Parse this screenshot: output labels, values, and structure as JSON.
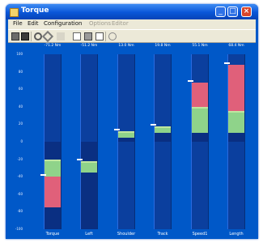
{
  "window": {
    "title": "Torque"
  },
  "menu": [
    {
      "label": "File",
      "dim": false
    },
    {
      "label": "Edit",
      "dim": false
    },
    {
      "label": "Configuration",
      "dim": false
    },
    {
      "label": "Options",
      "dim": true
    },
    {
      "label": "Editor",
      "dim": true
    }
  ],
  "toolbar": [
    "open-icon",
    "save-icon",
    "wrench-icon",
    "tools-icon",
    "blank-icon",
    "copy-icon",
    "print-icon",
    "paste-icon",
    "help-icon"
  ],
  "colors": {
    "background": "#0058c8",
    "track": "#0b3f9e",
    "range_base": "#0a2f82",
    "range_mid": "#8fd38a",
    "range_top": "#e0607a"
  },
  "axis": {
    "ticks": [
      "100",
      "80",
      "60",
      "40",
      "20",
      "0",
      "-20",
      "-40",
      "-60",
      "-80",
      "-100"
    ]
  },
  "bars": [
    {
      "name": "Torque",
      "title": "-71.2 Nm",
      "range": [
        -100,
        0
      ],
      "mid": [
        -40,
        -20
      ],
      "top": [
        -75,
        -40
      ]
    },
    {
      "name": "Left",
      "title": "-51.2 Nm",
      "range": [
        -100,
        0
      ],
      "mid": [
        -35,
        -22
      ],
      "top": null
    },
    {
      "name": "Shoulder",
      "title": "13.0 Nm",
      "range": [
        0,
        12
      ],
      "mid": [
        5,
        12
      ],
      "top": null
    },
    {
      "name": "Track",
      "title": "19.8 Nm",
      "range": [
        0,
        10
      ],
      "mid": [
        10,
        18
      ],
      "top": null
    },
    {
      "name": "Speed1",
      "title": "55.1 Nm",
      "range": [
        0,
        10
      ],
      "mid": [
        10,
        40
      ],
      "top": [
        40,
        68
      ]
    },
    {
      "name": "Length",
      "title": "68.4 Nm",
      "range": [
        0,
        10
      ],
      "mid": [
        10,
        35
      ],
      "top": [
        35,
        88
      ]
    }
  ]
}
